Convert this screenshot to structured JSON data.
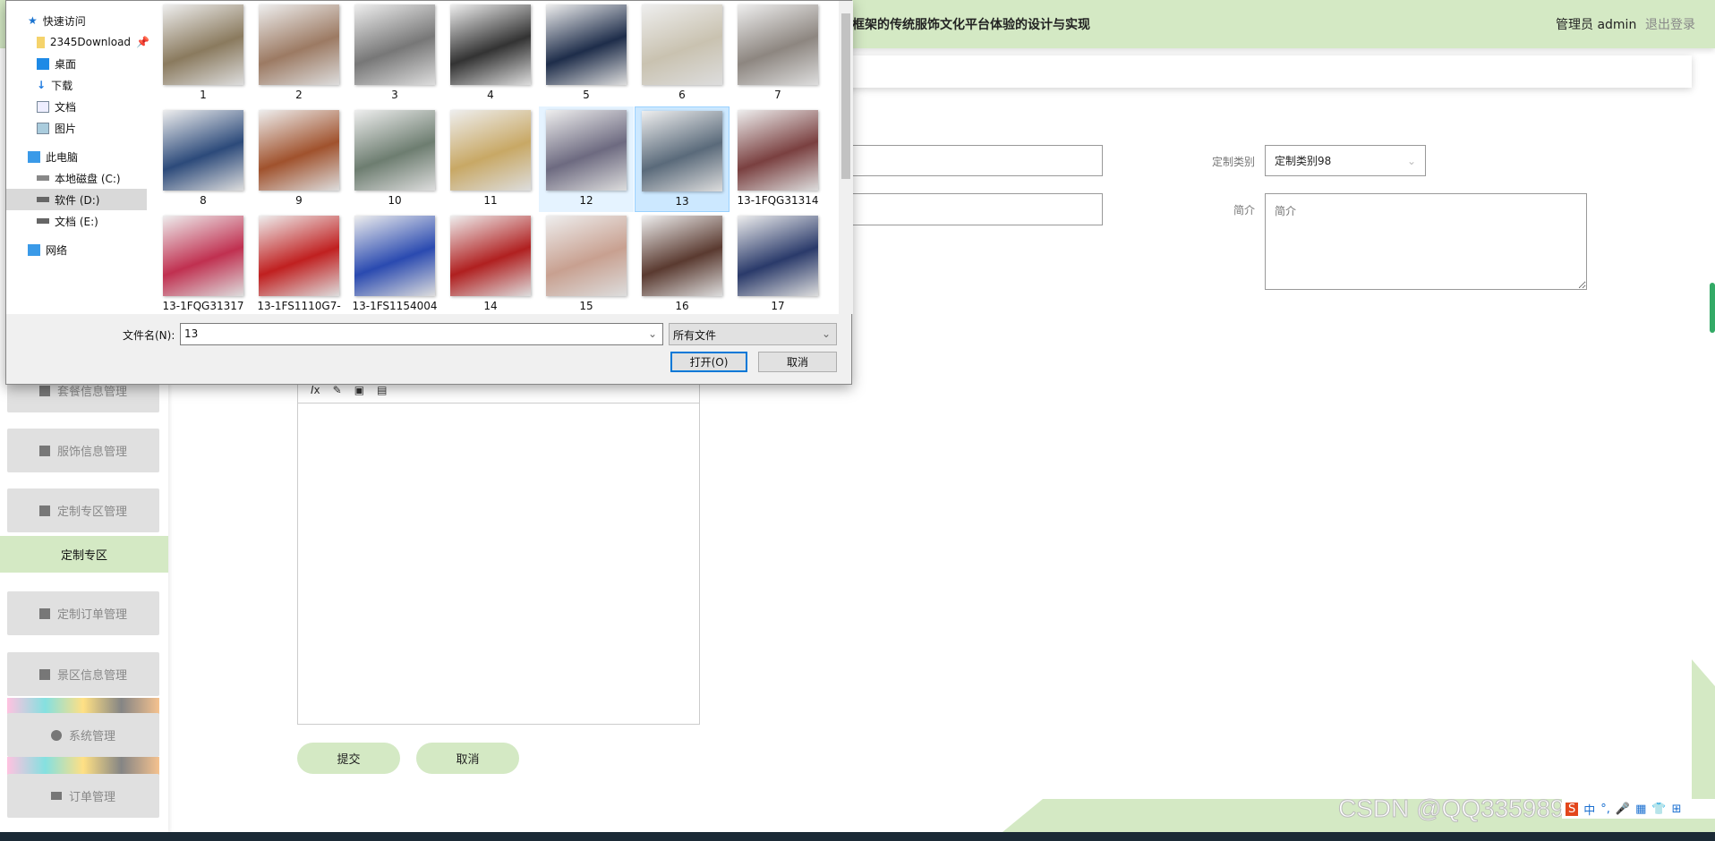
{
  "header": {
    "title": "框架的传统服饰文化平台体验的设计与实现",
    "user": "管理员 admin",
    "logout": "退出登录",
    "accent": "#d4e9c4"
  },
  "sidebar": {
    "items": [
      {
        "label": "套餐信息管理",
        "icon": "list-icon"
      },
      {
        "label": "服饰信息管理",
        "icon": "grid-icon"
      },
      {
        "label": "定制专区管理",
        "icon": "monitor-icon"
      },
      {
        "label": "定制订单管理",
        "icon": "grid-icon"
      },
      {
        "label": "景区信息管理",
        "icon": "grid-icon"
      },
      {
        "label": "系统管理",
        "icon": "bulb-icon"
      },
      {
        "label": "订单管理",
        "icon": "menu-icon"
      }
    ],
    "active": "定制专区"
  },
  "form": {
    "category_label": "定制类别",
    "category_value": "定制类别98",
    "intro_label": "简介",
    "intro_placeholder": "简介",
    "submit": "提交",
    "cancel": "取消"
  },
  "dialog": {
    "nav": [
      "快速访问",
      "2345Download",
      "桌面",
      "下载",
      "文档",
      "图片",
      "此电脑",
      "本地磁盘 (C:)",
      "软件 (D:)",
      "文档 (E:)",
      "网络"
    ],
    "files": [
      "1",
      "2",
      "3",
      "4",
      "5",
      "6",
      "7",
      "8",
      "9",
      "10",
      "11",
      "12",
      "13",
      "13-1FQG31314",
      "13-1FQG31317",
      "13-1FS1110G7-",
      "13-1FS1154004",
      "14",
      "15",
      "16",
      "17"
    ],
    "selected": "13",
    "filename_label": "文件名(N):",
    "filename_value": "13",
    "filter": "所有文件",
    "open": "打开(O)",
    "cancel": "取消"
  },
  "watermark": "CSDN @QQ3359892174"
}
